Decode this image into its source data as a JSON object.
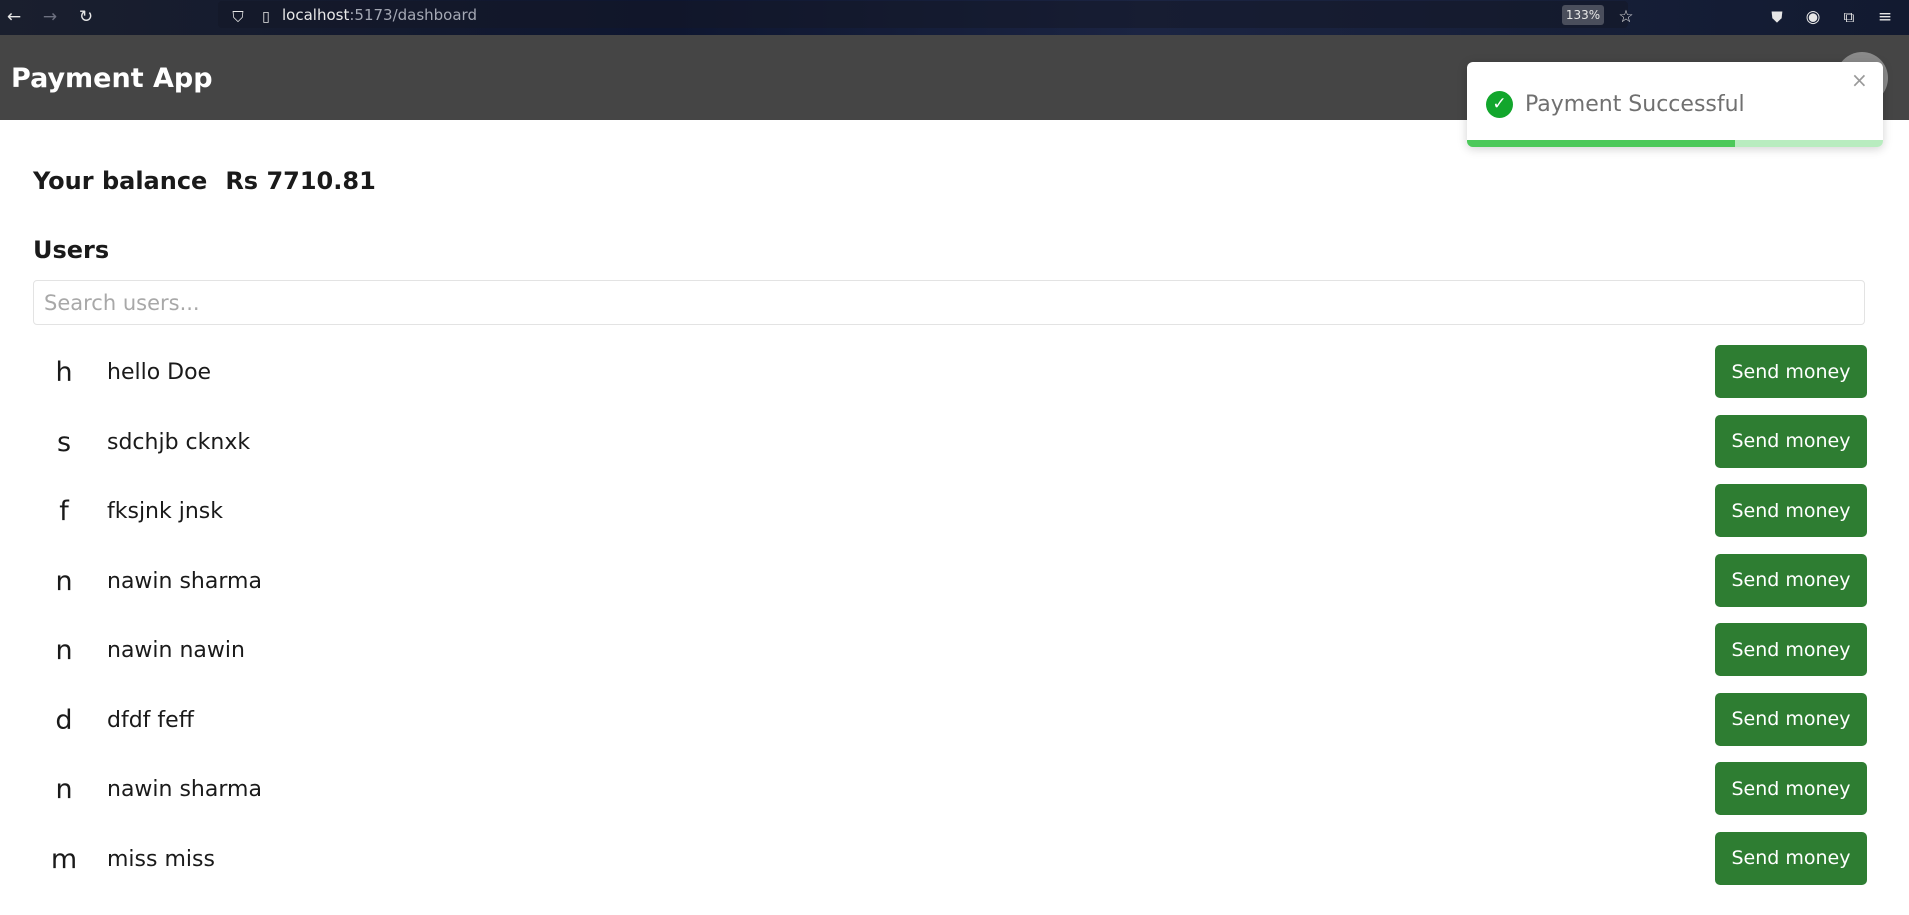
{
  "browser": {
    "url_host": "localhost",
    "url_path": ":5173/dashboard",
    "zoom": "133%"
  },
  "header": {
    "title": "Payment App"
  },
  "toast": {
    "message": "Payment Successful",
    "close_symbol": "×",
    "progress": 0.645,
    "color_success": "#12a62c"
  },
  "balance": {
    "label": "Your balance",
    "amount": "Rs 7710.81"
  },
  "users": {
    "heading": "Users",
    "search_placeholder": "Search users...",
    "send_label": "Send money",
    "list": [
      {
        "initial": "h",
        "name": "hello Doe"
      },
      {
        "initial": "s",
        "name": "sdchjb cknxk"
      },
      {
        "initial": "f",
        "name": "fksjnk jnsk"
      },
      {
        "initial": "n",
        "name": "nawin sharma"
      },
      {
        "initial": "n",
        "name": "nawin nawin"
      },
      {
        "initial": "d",
        "name": "dfdf feff"
      },
      {
        "initial": "n",
        "name": "nawin sharma"
      },
      {
        "initial": "m",
        "name": "miss miss"
      }
    ]
  },
  "colors": {
    "header_bg": "#454545",
    "button_bg": "#2e7d32"
  }
}
